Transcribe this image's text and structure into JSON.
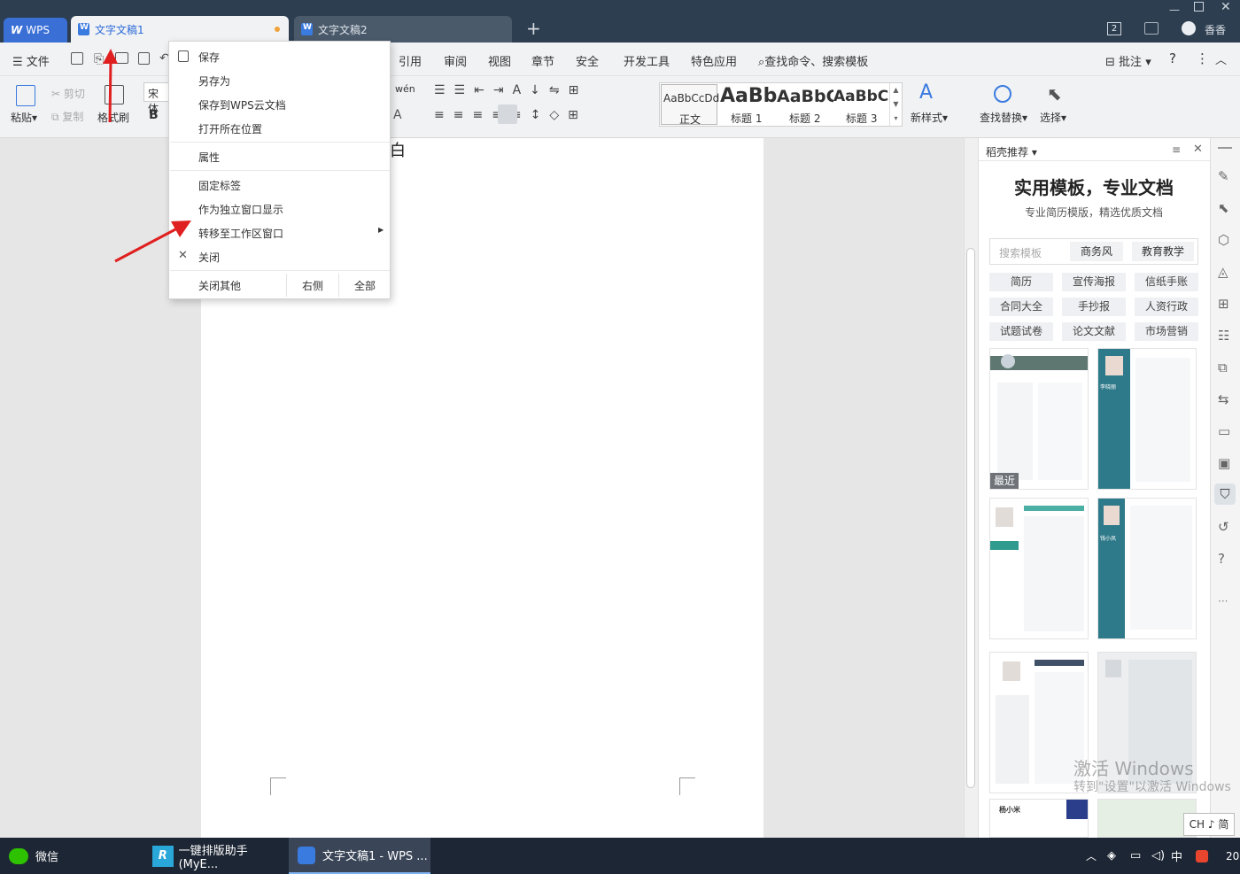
{
  "titlebar": {
    "wps_tab": "WPS",
    "tabs": [
      {
        "label": "文字文稿1",
        "active": true
      },
      {
        "label": "文字文稿2",
        "active": false
      }
    ],
    "add_tab": "+",
    "badge": "2",
    "user": "香香"
  },
  "menu": {
    "file": "文件",
    "items": [
      "引用",
      "审阅",
      "视图",
      "章节",
      "安全",
      "开发工具",
      "特色应用"
    ],
    "search": "查找命令、搜索模板",
    "comment": "批注",
    "help": "?"
  },
  "ribbon": {
    "paste": "粘贴",
    "cut": "剪切",
    "copy": "复制",
    "format_painter": "格式刷",
    "font": "宋体",
    "bold": "B",
    "pinyin": "wén",
    "styles": [
      {
        "preview": "AaBbCcDd",
        "label": "正文"
      },
      {
        "preview": "AaBb",
        "label": "标题 1"
      },
      {
        "preview": "AaBbC",
        "label": "标题 2"
      },
      {
        "preview": "AaBbCc",
        "label": "标题 3"
      }
    ],
    "new_style": "新样式",
    "find_replace": "查找替换",
    "select": "选择"
  },
  "document": {
    "text": "白"
  },
  "context_menu": {
    "items": [
      "保存",
      "另存为",
      "保存到WPS云文档",
      "打开所在位置",
      "属性",
      "固定标签",
      "作为独立窗口显示",
      "转移至工作区窗口",
      "关闭"
    ],
    "close_others": "关闭其他",
    "right": "右侧",
    "all": "全部"
  },
  "panel": {
    "title": "稻壳推荐",
    "headline": "实用模板，专业文档",
    "subline": "专业简历模版，精选优质文档",
    "search_placeholder": "搜索模板",
    "search_tags": [
      "商务风",
      "教育教学"
    ],
    "categories": [
      "简历",
      "宣传海报",
      "信纸手账",
      "合同大全",
      "手抄报",
      "人资行政",
      "试题试卷",
      "论文文献",
      "市场营销"
    ],
    "recent": "最近",
    "resume_name1": "李晓丽",
    "resume_name2": "杨小米",
    "resume_name3": "钱小凤"
  },
  "watermark": {
    "line1": "激活 Windows",
    "line2": "转到\"设置\"以激活 Windows"
  },
  "ime": "CH ♪ 简",
  "taskbar": {
    "apps": [
      "微信",
      "一键排版助手(MyE...",
      "文字文稿1 - WPS ..."
    ],
    "tray": [
      "中"
    ],
    "clock": "20"
  },
  "colors": {
    "accent": "#3a7be0",
    "title_bg": "#2d3e50",
    "arrow": "#e02020",
    "teal": "#2f7a8a"
  }
}
